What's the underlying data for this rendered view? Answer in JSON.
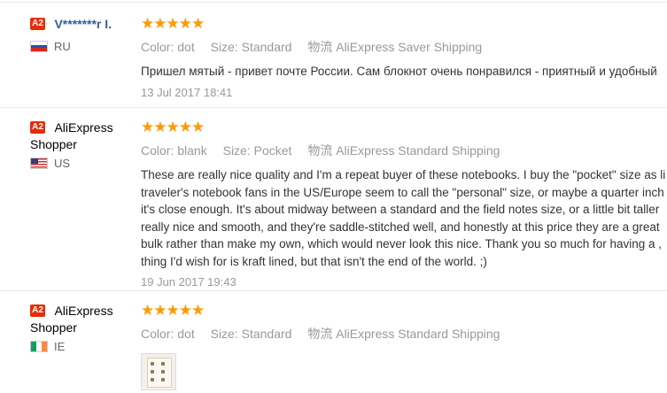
{
  "labels": {
    "color": "Color:",
    "size": "Size:",
    "shipping_icon_text": "物流"
  },
  "reviews": [
    {
      "badge": "A2",
      "name": "V*******r I.",
      "country": "RU",
      "stars": "★★★★★",
      "color": "dot",
      "size": "Standard",
      "shipping": "AliExpress Saver Shipping",
      "text": [
        "Пришел мятый - привет почте России. Сам блокнот очень понравился - приятный и удобный"
      ],
      "date": "13 Jul 2017 18:41"
    },
    {
      "badge": "A2",
      "name_line1": "AliExpress",
      "name_line2": "Shopper",
      "country": "US",
      "stars": "★★★★★",
      "color": "blank",
      "size": "Pocket",
      "shipping": "AliExpress Standard Shipping",
      "text": [
        "These are really nice quality and I'm a repeat buyer of these notebooks. I buy the \"pocket\" size as li",
        "traveler's notebook fans in the US/Europe seem to call the \"personal\" size, or maybe a quarter inch",
        "it's close enough. It's about midway between a standard and the field notes size, or a little bit taller",
        "really nice and smooth, and they're saddle-stitched well, and honestly at this price they are a great",
        "bulk rather than make my own, which would never look this nice. Thank you so much for having a ,",
        "thing I'd wish for is kraft lined, but that isn't the end of the world. ;)"
      ],
      "date": "19 Jun 2017 19:43"
    },
    {
      "badge": "A2",
      "name_line1": "AliExpress",
      "name_line2": "Shopper",
      "country": "IE",
      "stars": "★★★★★",
      "color": "dot",
      "size": "Standard",
      "shipping": "AliExpress Standard Shipping"
    }
  ]
}
